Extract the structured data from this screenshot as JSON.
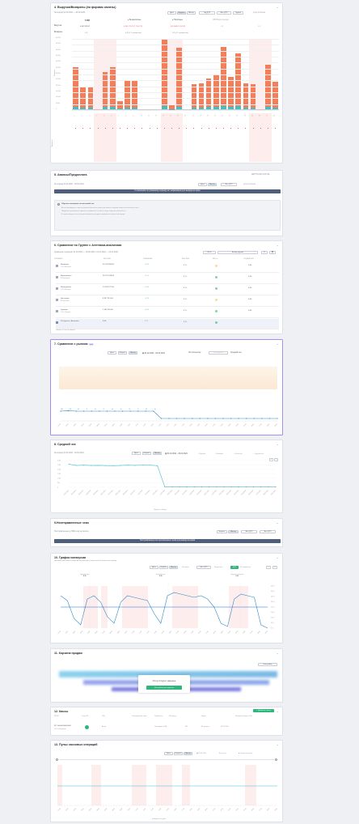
{
  "cards": {
    "c1": {
      "title": "4. Выручка/Возвраты (по формам оплаты)",
      "period": "За период 01.02.2024 — 29.02.2024",
      "buttons": [
        "День",
        "Неделя",
        "Месяц"
      ],
      "extras": [
        "Год ДТЛ",
        "Все ДТЛ",
        "Группа",
        "Кумулятивная"
      ],
      "summary_total": "5 000",
      "summary_labels": [
        "Выручка",
        "Возвраты"
      ],
      "cols": [
        {
          "name": "Безналичные",
          "v1": "4 612 281 ₽",
          "v2": "4 692 791 ₽ (1 703,7 ₽)"
        },
        {
          "name": "Наличные",
          "v1": "420 888 ₽ (43,9 ₽)",
          "v2": "0 ₽"
        },
        {
          "name": "СБП/Электронные",
          "v1": "0 ₽",
          "v2": "0 ₽"
        }
      ],
      "refund_sub": [
        "0 ₽",
        "0 ₽ (0 % возвратов)",
        "0 ₽ (0 % возвратов)"
      ],
      "y_ticks": [
        "600 000",
        "550 000",
        "500 000",
        "450 000",
        "400 000",
        "350 000",
        "300 000",
        "250 000",
        "200 000",
        "150 000",
        "100 000",
        "50 000",
        "0"
      ],
      "ylabel": "Выручка",
      "ylabel2": "Возвраты"
    },
    "c2": {
      "title": "5. Авансы/Предоплата",
      "toggle": "Расширенный вид",
      "period": "За период 01.02.2024 - 29.02.2024",
      "buttons": [
        "День",
        "Месяц"
      ],
      "extras": [
        "Все ДТЛ",
        "Кумулятивная"
      ],
      "bar": "К сожалению по указанному периоду нет информации для вывода на экран",
      "note_title": "Обратите внимание на кассовый чек",
      "note_lines": [
        "Авансы формируются при поступлении денежных средств до момента отгрузки товара или оказания услуги.",
        "Предоплата учитывается отдельно и отражается в отчёте по мере закрытия обязательств.",
        "В случае возврата аванса сумма отражается в разделе возвратов за выбранный период."
      ]
    },
    "c3": {
      "title": "6. Сравнение по Группе с Агентами-аналогами",
      "period": "Сравнение периодов: 01.02.2024 — 29.02.2024 / 01.01.2024 — 31.01.2024",
      "filter": "Выбор группы",
      "headers": [
        "КОМПАНИЯ",
        "ВЫРУЧКА",
        "ИЗМЕНЕНИЕ",
        "ВЫБОРКА",
        "КАССЫ",
        "СРЕДНИЙ ЧЕК"
      ],
      "rows": [
        {
          "name": "Волжские",
          "sub": "ООО «Волжские»",
          "rev": "55 704 285,00",
          "chg": "+4 %",
          "w": "4 %",
          "chk": "0,00"
        },
        {
          "name": "Ворошиловы",
          "sub": "ИП Ворошилов",
          "rev": "56 797 078,00",
          "chg": "+1 %",
          "w": "4 %",
          "chk": "0,00"
        },
        {
          "name": "Шпатцеровы",
          "sub": "ООО «Шпатцер»",
          "rev": "15 206 577,00",
          "chg": "+3 %",
          "w": "4 %",
          "chk": "0,00"
        },
        {
          "name": "Чистякова",
          "sub": "ИП Чистякова",
          "rev": "8 937 813,00",
          "chg": "+2 %",
          "w": "4 %",
          "chk": "0,00"
        },
        {
          "name": "Гринкам",
          "sub": "ООО «Гринкам»",
          "rev": "1 035 924,00",
          "chg": "+5 %",
          "w": "4 %",
          "chk": "0,00"
        },
        {
          "name": "Из Группы с Агентами",
          "sub": "",
          "rev": "0,00",
          "chg": "0 %",
          "w": "0 %",
          "chk": ""
        }
      ],
      "footer": "Показаны 1-6 из 6 записей"
    },
    "c4": {
      "title": "7. Сравнение с рынком",
      "badge": "NEW",
      "buttons": [
        "День",
        "Неделя",
        "Месяц"
      ],
      "range": "01.02.2024 - 29.02.2024",
      "extras": [
        "По количеству",
        "По выручке",
        "Средний чек"
      ],
      "points": [
        "184",
        "196",
        "62",
        "71",
        "61",
        "67",
        "60",
        "70",
        "78",
        "71",
        "58",
        "74"
      ]
    },
    "c5": {
      "title": "8. Средний чек",
      "period": "За период 01.02.2024 - 29.02.2024",
      "buttons": [
        "День",
        "Неделя",
        "Месяц"
      ],
      "range": "01.02.2024 - 29.02.2024",
      "legend_items": [
        "Выручка",
        "Возвраты",
        "Наличные",
        "Средний чек"
      ],
      "y_ticks": [
        "3 000",
        "2 500",
        "2 000",
        "1 500",
        "1 000",
        "500",
        "0"
      ],
      "footer": "Показать таблицу"
    },
    "c6": {
      "title": "9.Неотправленные чеки",
      "period": "Неотправленные в ОФД чеки за период",
      "buttons": [
        "Неделя",
        "Месяц"
      ],
      "extras": [
        "Все ДТЛ",
        "Все ДТЛ"
      ],
      "bar": "Неотправленных или неоплаченных чеков для вывода на экран"
    },
    "c7": {
      "title": "10. График конверсии",
      "subtitle": "Динамика изменения конверсии посетителей в покупателей за выбранный период",
      "buttons": [
        "День",
        "Неделя",
        "Месяц"
      ],
      "extras": [
        "Итоговые",
        "Все ДТЛ",
        "Результаты",
        "ДТЛ",
        "По количеству"
      ],
      "annotations": [
        {
          "t": "Худший день",
          "v": "0 %"
        },
        {
          "t": "Лучший день",
          "v": "0 %"
        },
        {
          "t": "Среднее значение",
          "v": "0 %"
        }
      ],
      "y_ticks": [
        "400 %",
        "350 %",
        "300 %",
        "250 %",
        "200 %",
        "150 %",
        "100 %",
        "50 %",
        "0 %"
      ]
    },
    "c8": {
      "title": "11. Корзина продаж",
      "button": "Настройки",
      "nodata": "Отсутствуют данные",
      "nodata_btn": "Настройте учет данных"
    },
    "c9": {
      "title": "12. Кассы",
      "add": "+ Добавить кассу",
      "headers": [
        "ККТ/ФН",
        "Статус ККТ",
        "ОФД",
        "Регистрационный номер",
        "Серийный №",
        "ФН годен до",
        "Модель",
        "Последняя отправка в ОФД"
      ],
      "row": {
        "name": "ККТ №0000000000000",
        "sub": "ООО «Ромашка»",
        "status": "Актив",
        "ofd": "Платформа ОФД",
        "reg": "356",
        "sn": "Не указано",
        "date": "29.02.2024"
      }
    },
    "c10": {
      "title": "13. Пульс кассовых операций",
      "buttons": [
        "День",
        "Неделя",
        "Месяц"
      ],
      "range": "01.02.2024",
      "extras": [
        "Все кассы",
        "Количество чеков"
      ],
      "legend": "Выручка по дням"
    }
  },
  "colors": {
    "accent": "#2fb67c",
    "bar": "#f47d5a",
    "teal": "#3cc1c9",
    "line": "#2e8bc8",
    "purple": "#a48ef0"
  },
  "chart_data": [
    {
      "type": "bar",
      "title": "",
      "categories": [
        "1",
        "2",
        "3",
        "4",
        "5",
        "6",
        "7",
        "8",
        "9",
        "10",
        "11",
        "12",
        "13",
        "14",
        "15",
        "16",
        "17",
        "18",
        "19",
        "20",
        "21",
        "22",
        "23",
        "24",
        "25",
        "26",
        "27",
        "28"
      ],
      "series": [
        {
          "name": "Безналичные",
          "values": [
            335000,
            170000,
            175000,
            0,
            295000,
            340000,
            60000,
            225000,
            225000,
            0,
            0,
            0,
            570000,
            30000,
            495000,
            0,
            195000,
            205000,
            240000,
            275000,
            500000,
            250000,
            440000,
            205000,
            200000,
            0,
            355000,
            215000
          ]
        },
        {
          "name": "Наличные",
          "values": [
            20000,
            15000,
            15000,
            0,
            18000,
            18000,
            5000,
            15000,
            14000,
            0,
            0,
            0,
            25000,
            2000,
            22000,
            0,
            15000,
            12000,
            18000,
            20000,
            25000,
            20000,
            30000,
            15000,
            14000,
            0,
            20000,
            15000
          ]
        }
      ],
      "ylim": [
        0,
        600000
      ]
    },
    {
      "type": "line",
      "title": "",
      "series": [
        {
          "name": "Средний чек",
          "values": [
            2600,
            2450,
            2480,
            2450,
            2460,
            2440,
            2430,
            2450,
            2480,
            2460,
            2500,
            2480,
            2420,
            50,
            50,
            50,
            50,
            50,
            50,
            50,
            50,
            50,
            50,
            50,
            50,
            50,
            50,
            50,
            50
          ]
        }
      ],
      "ylim": [
        0,
        3000
      ]
    }
  ]
}
